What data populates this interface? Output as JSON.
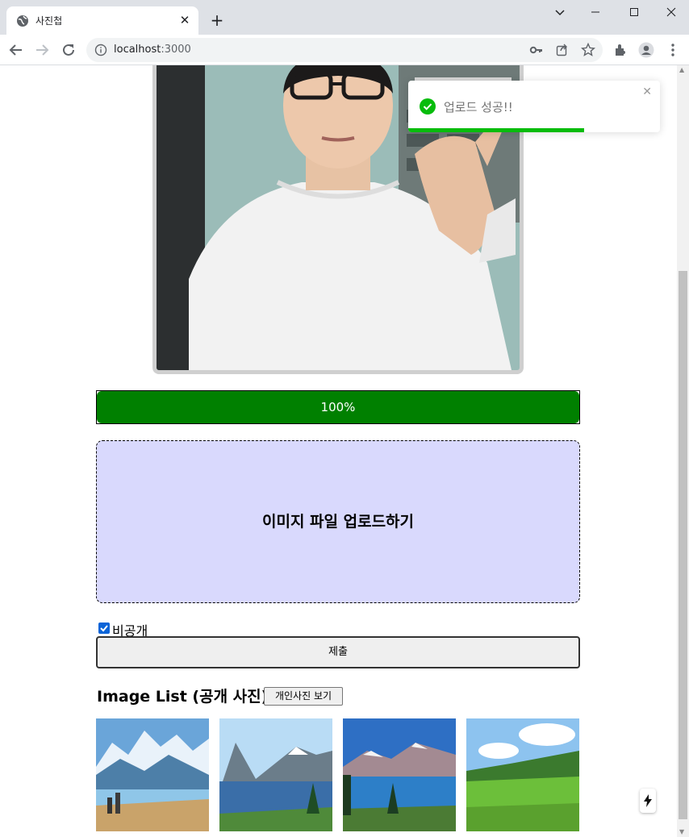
{
  "tab": {
    "title": "사진첩",
    "close": "✕",
    "new_tab": "+"
  },
  "toolbar": {
    "url_host": "localhost",
    "url_port": ":3000"
  },
  "upload": {
    "progress_label": "100%",
    "progress_fraction": 1.0,
    "dropzone_label": "이미지 파일 업로드하기",
    "private_label": "비공개",
    "private_checked": true,
    "submit_label": "제출"
  },
  "list": {
    "title": "Image List (공개 사진)",
    "toggle_label": "개인사진 보기"
  },
  "toast": {
    "message": "업로드 성공!!",
    "close": "✕",
    "remaining_fraction": 0.7
  },
  "colors": {
    "progress_fill": "#008000",
    "dropzone_bg": "#d9d9fd",
    "toast_accent": "#07bc0c",
    "checkbox_accent": "#0b64d8"
  },
  "icons": [
    "globe-icon",
    "close-icon",
    "plus-icon",
    "chevron-down-icon",
    "minimize-icon",
    "maximize-icon",
    "window-close-icon",
    "back-icon",
    "forward-icon",
    "reload-icon",
    "info-icon",
    "key-icon",
    "share-icon",
    "star-icon",
    "extensions-icon",
    "profile-icon",
    "menu-icon",
    "check-circle-icon",
    "lightning-icon"
  ]
}
